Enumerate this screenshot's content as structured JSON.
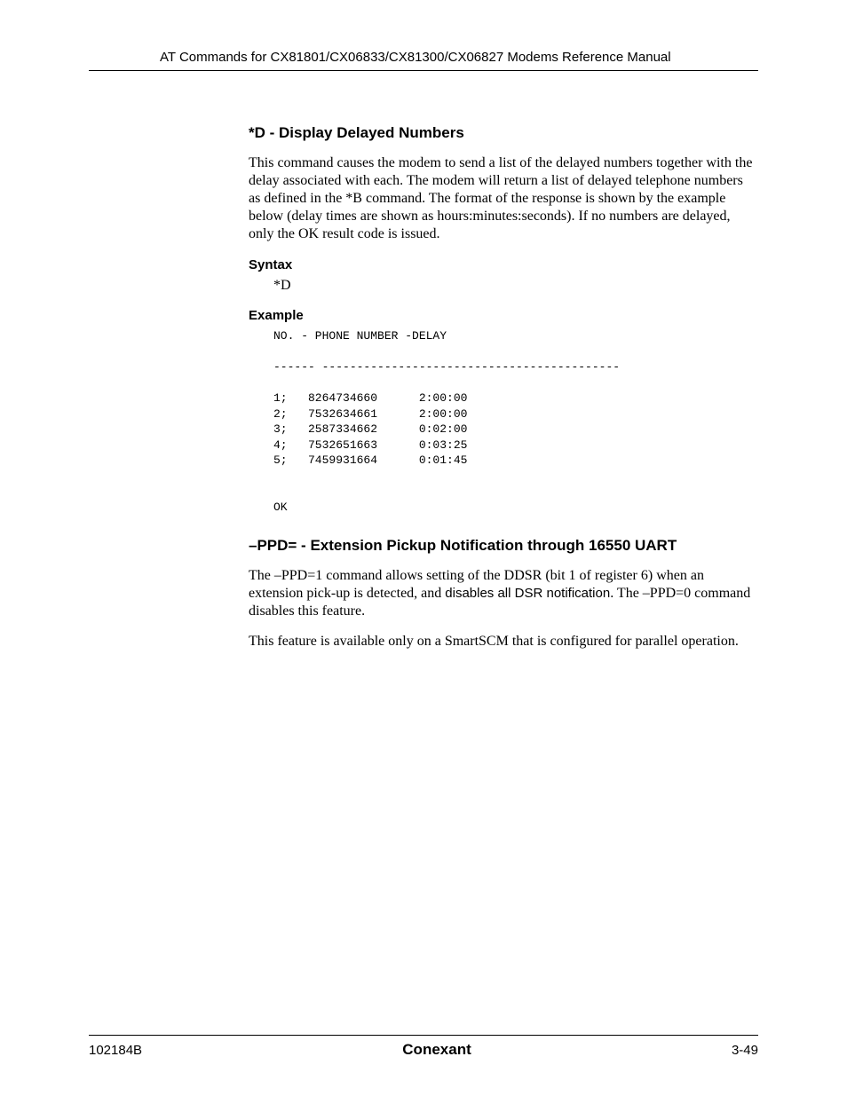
{
  "header": {
    "running": "AT Commands for CX81801/CX06833/CX81300/CX06827 Modems Reference Manual"
  },
  "section1": {
    "heading": "*D - Display Delayed Numbers",
    "para": "This command causes the modem to send a list of the delayed numbers together with the delay associated with each. The modem will return a list of delayed telephone numbers as defined in the *B command. The format of the response is shown by the example below (delay times are shown as hours:minutes:seconds). If no numbers are delayed, only the OK result code is issued.",
    "syntax_label": "Syntax",
    "syntax_value": "*D",
    "example_label": "Example",
    "example_block": "NO. - PHONE NUMBER -DELAY\n\n------ -------------------------------------------\n\n1;   8264734660      2:00:00\n2;   7532634661      2:00:00\n3;   2587334662      0:02:00\n4;   7532651663      0:03:25\n5;   7459931664      0:01:45\n\n\nOK"
  },
  "section2": {
    "heading": "–PPD= - Extension Pickup Notification through 16550 UART",
    "para1_a": "The –PPD=1 command allows setting of the DDSR (bit 1 of register 6) when an extension pick-up is detected, and ",
    "para1_b": "disables all DSR notification",
    "para1_c": ". The –PPD=0 command disables this feature.",
    "para2": "This feature is available only on a SmartSCM that is configured for parallel operation."
  },
  "footer": {
    "left": "102184B",
    "center": "Conexant",
    "right": "3-49"
  }
}
